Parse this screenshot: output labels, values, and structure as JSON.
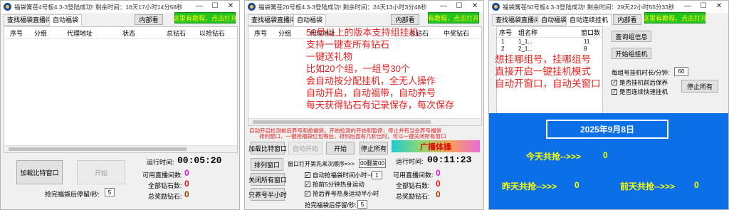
{
  "w1": {
    "title": "福袋篝荏4号板4.3-3登陆成功! 剩余时间：16天17小时14分58秒",
    "min": "—",
    "max": "☐",
    "close": "✕",
    "tabs": [
      "查找福袋直播间",
      "自动福袋"
    ],
    "inner_btn": "内部看",
    "help_btn": "这里有教程，点击打开",
    "table_headers": [
      "序号",
      "分组",
      "代理地址",
      "状态",
      "总钻石",
      "以抢钻石"
    ],
    "btn_add": "加载比特窗口",
    "btn_start": "开始",
    "run_label": "运行时间:",
    "run_time": "00:05:20",
    "live_label": "可用直播间数:",
    "live_value": "0",
    "diamond_label": "全部钻石数:",
    "diamond_value": "0",
    "reward_label": "总奖励钻石:",
    "reward_value": "0",
    "wait_label": "抢完福袋后停留/秒:",
    "wait_value": "5"
  },
  "w2": {
    "title": "福袋篝荏20号板4.3-3登陆成功! 剩余时间：24天13小时3分48秒",
    "min": "—",
    "max": "☐",
    "close": "✕",
    "tabs": [
      "查找福袋直播间",
      "自动福袋"
    ],
    "inner_btn": "内部看",
    "help_btn": "有教程，点击打开",
    "table_headers": [
      "序号",
      "分组",
      "代理地址",
      "总钻石",
      "中奖钻石"
    ],
    "overlay": [
      "50号以上的版本支持组挂机",
      "支持一键查所有钻石",
      "一键送礼物",
      "比如20个组，一组号30个",
      "会自动按分配挂机，全无人操作",
      "自动开启，自动福带，自动养号",
      "每天获得钻石有记录保存，每次保存"
    ],
    "red_note_1": "自动开启检测前后养号和抢福袋，开始检测的开始和暂停；停止并有当会养号福袋",
    "red_note_2": "排列窗口，一键抢福袋红包等后，排列后直有几秒出时，可以一键关闭所有窗口",
    "btn_load": "加载比特窗口",
    "btn_auto": "自动开始",
    "btn_start": "开始",
    "btn_stop_all": "停止所有",
    "banner": "广播体操",
    "btn_arrange": "排列窗口",
    "timing_label": "窗口打开第先来次顺序=>>",
    "timing_value": "00翻第00",
    "btn_close_all": "关闭所有窗口",
    "btn_half_hour": "只养号半小时",
    "run_label": "运行时间:",
    "run_time": "00:11:23",
    "live_label": "可用直播间数:",
    "live_value": "0",
    "diamond_label": "全部钻石数:",
    "diamond_value": "0",
    "reward_label": "总奖励钻石:",
    "reward_value": "0",
    "opt1": "自动抢福袋时间小时~9",
    "opt1_value": "1",
    "opt2": "抢前5分钟热身运动",
    "opt3": "抢后养号热身运动半小时",
    "wait_label": "抢完福袋后停留/秒:",
    "wait_value": "5"
  },
  "w3": {
    "title": "福袋篝荏50号板4.3-3登陆成功! 剩余时间：29天22小时55分33秒",
    "min": "—",
    "max": "☐",
    "close": "✕",
    "tabs": [
      "查找福袋直播间",
      "自动福袋",
      "自动连续挂机"
    ],
    "inner_btn": "内部看",
    "help_btn": "这里有教程，点击打开",
    "table_headers": [
      "序号",
      "组名称",
      "窗口数"
    ],
    "rows": [
      {
        "idx": "1",
        "name": "1_1...",
        "count": "11"
      },
      {
        "idx": "2",
        "name": "2_1...",
        "count": "8"
      }
    ],
    "btn_query": "查询组信息",
    "btn_start_group": "开始组挂机",
    "overlay": [
      "想挂哪组号，挂哪组号",
      "直接开启一键挂机模式",
      "自动开窗口，自动关窗口"
    ],
    "duration_label": "每组号挂机时长/分钟:",
    "duration_value": "60",
    "opt1": "是否挂机前后保养",
    "opt2": "是否连续快速挂机",
    "btn_stop_all": "停止所有",
    "date": "2025年9月8日",
    "today_label": "今天共抢-->>>",
    "today_value": "0",
    "yesterday_label": "昨天共抢-->>>",
    "yesterday_value": "0",
    "before_label": "前天共抢-->>>",
    "before_value": "0"
  }
}
